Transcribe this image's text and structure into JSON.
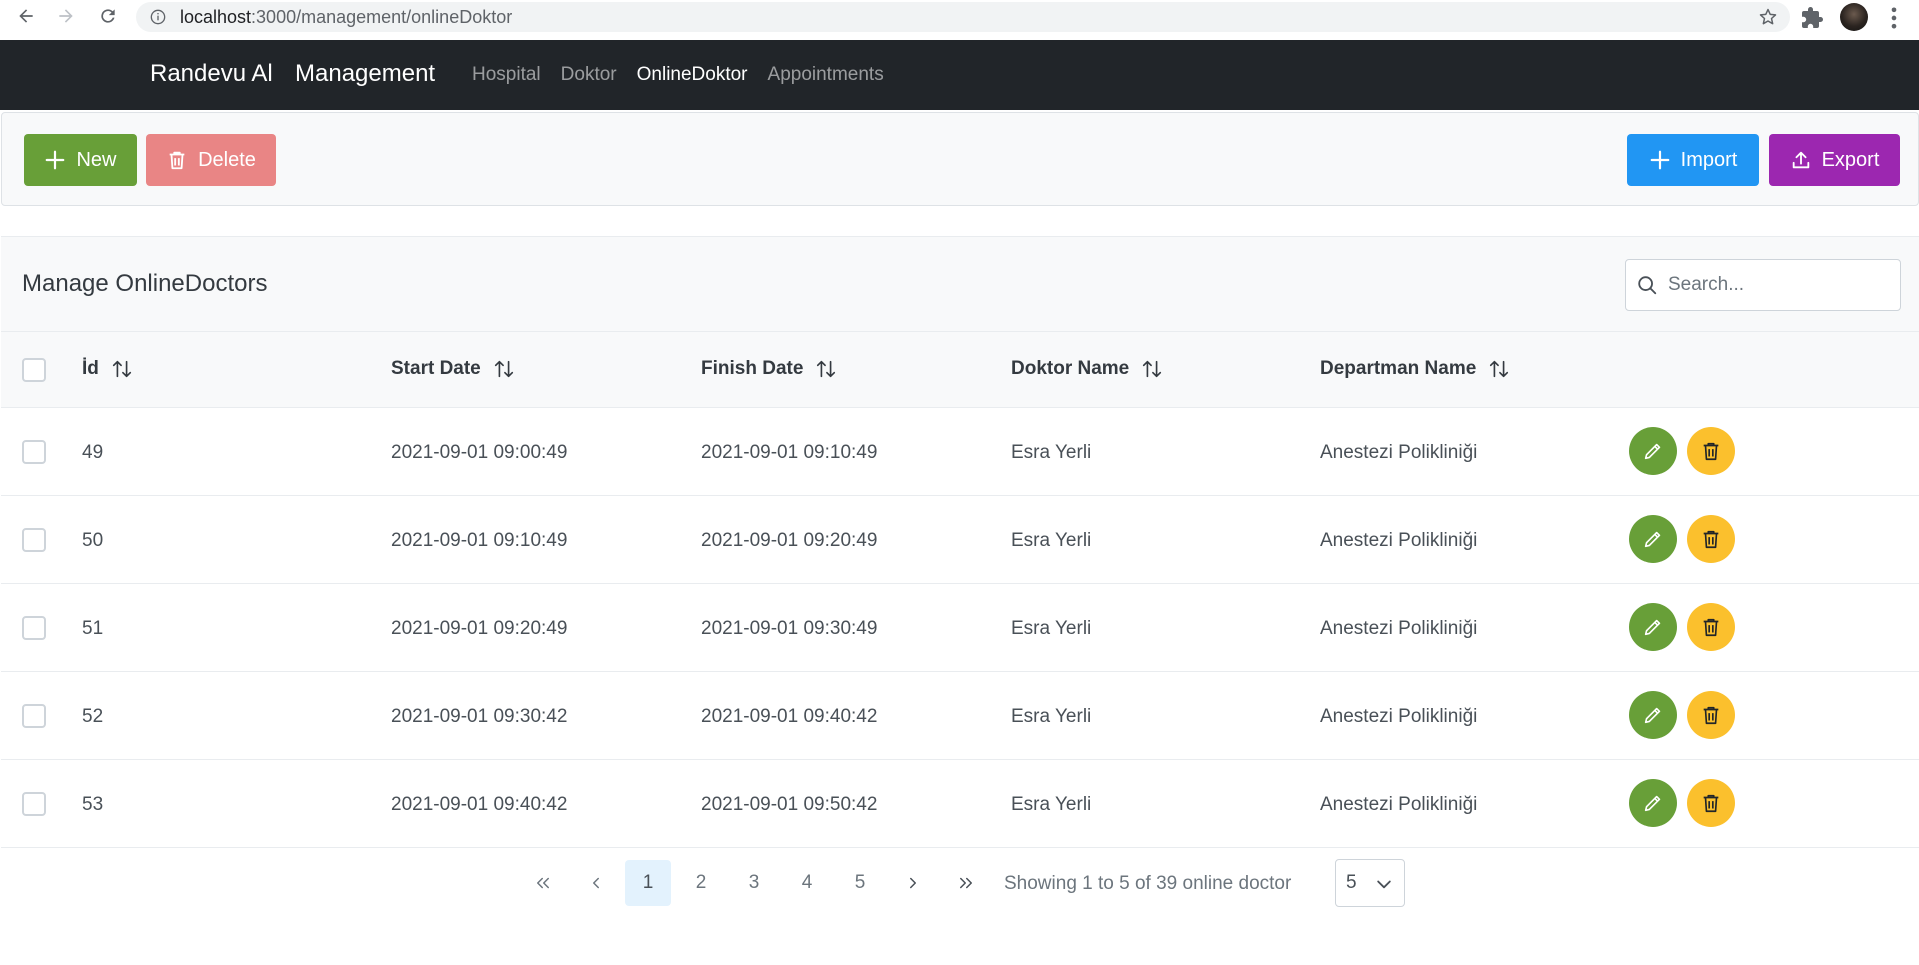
{
  "browser": {
    "url_host": "localhost",
    "url_path": ":3000/management/onlineDoktor"
  },
  "navbar": {
    "brand": "Randevu Al",
    "section": "Management",
    "links": [
      {
        "label": "Hospital",
        "active": false
      },
      {
        "label": "Doktor",
        "active": false
      },
      {
        "label": "OnlineDoktor",
        "active": true
      },
      {
        "label": "Appointments",
        "active": false
      }
    ]
  },
  "toolbar": {
    "new_label": "New",
    "delete_label": "Delete",
    "import_label": "Import",
    "export_label": "Export"
  },
  "table": {
    "title": "Manage OnlineDoctors",
    "search_placeholder": "Search...",
    "columns": [
      "İd",
      "Start Date",
      "Finish Date",
      "Doktor Name",
      "Departman Name"
    ],
    "rows": [
      {
        "id": "49",
        "start": "2021-09-01 09:00:49",
        "finish": "2021-09-01 09:10:49",
        "doktor": "Esra Yerli",
        "departman": "Anestezi Polikliniği"
      },
      {
        "id": "50",
        "start": "2021-09-01 09:10:49",
        "finish": "2021-09-01 09:20:49",
        "doktor": "Esra Yerli",
        "departman": "Anestezi Polikliniği"
      },
      {
        "id": "51",
        "start": "2021-09-01 09:20:49",
        "finish": "2021-09-01 09:30:49",
        "doktor": "Esra Yerli",
        "departman": "Anestezi Polikliniği"
      },
      {
        "id": "52",
        "start": "2021-09-01 09:30:42",
        "finish": "2021-09-01 09:40:42",
        "doktor": "Esra Yerli",
        "departman": "Anestezi Polikliniği"
      },
      {
        "id": "53",
        "start": "2021-09-01 09:40:42",
        "finish": "2021-09-01 09:50:42",
        "doktor": "Esra Yerli",
        "departman": "Anestezi Polikliniği"
      }
    ]
  },
  "paginator": {
    "pages": [
      "1",
      "2",
      "3",
      "4",
      "5"
    ],
    "current": "1",
    "report": "Showing 1 to 5 of 39 online doctor",
    "rows_per_page": "5"
  },
  "colors": {
    "navbar": "#212529",
    "new": "#689f38",
    "delete": "#e98585",
    "import": "#2196f3",
    "export": "#9c27b0",
    "edit_action": "#689f38",
    "delete_action": "#fbc02d"
  }
}
